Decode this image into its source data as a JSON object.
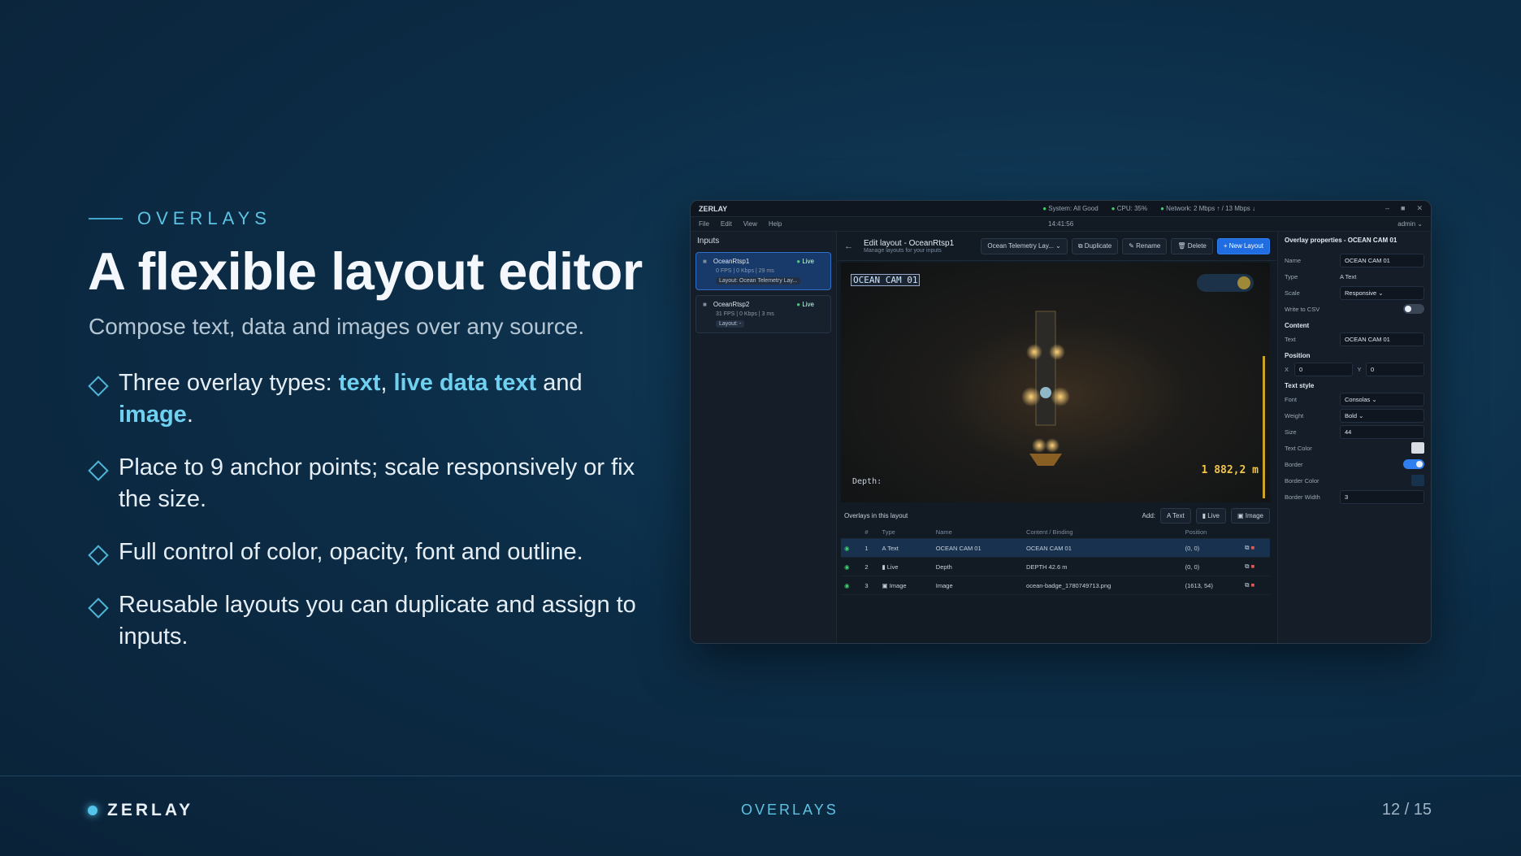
{
  "slide": {
    "kicker": "OVERLAYS",
    "title": "A flexible layout editor",
    "subtitle": "Compose text, data and images over any source.",
    "bullets": {
      "b1_pre": "Three overlay types: ",
      "b1_text": "text",
      "b1_sep": ", ",
      "b1_live": "live data text",
      "b1_and": " and ",
      "b1_image": "image",
      "b1_end": ".",
      "b2": "Place to 9 anchor points; scale responsively or fix the size.",
      "b3": "Full control of color, opacity, font and outline.",
      "b4": "Reusable layouts you can duplicate and assign to inputs."
    },
    "footer": {
      "brand": "ZERLAY",
      "section": "OVERLAYS",
      "page": "12 / 15"
    }
  },
  "app": {
    "title": "ZERLAY",
    "status": {
      "system": "System: All Good",
      "cpu": "CPU: 35%",
      "network": "Network: 2 Mbps ↑ / 13 Mbps ↓"
    },
    "menu": [
      "File",
      "Edit",
      "View",
      "Help"
    ],
    "clock": "14:41:56",
    "user": "admin",
    "inputs_header": "Inputs",
    "inputs": [
      {
        "name": "OceanRtsp1",
        "status": "Live",
        "meta": "0 FPS  |  0 Kbps  |  29 ms",
        "layout": "Layout: Ocean Telemetry Lay..."
      },
      {
        "name": "OceanRtsp2",
        "status": "Live",
        "meta": "31 FPS  |  0 Kbps  |  3 ms",
        "layout": "Layout: -"
      }
    ],
    "editor": {
      "title": "Edit layout - OceanRtsp1",
      "subtitle": "Manage layouts for your inputs",
      "layout_select": "Ocean Telemetry Lay...",
      "duplicate": "Duplicate",
      "rename": "Rename",
      "delete": "Delete",
      "new_layout": "+ New Layout"
    },
    "preview": {
      "cam_label": "OCEAN CAM 01",
      "depth_label": "Depth:",
      "depth_value": "1 882,2 m"
    },
    "overlays": {
      "header": "Overlays in this layout",
      "add_label": "Add:",
      "add_text": "Text",
      "add_live": "Live",
      "add_image": "Image",
      "columns": [
        "#",
        "Type",
        "Name",
        "Content / Binding",
        "Position"
      ],
      "rows": [
        {
          "n": "1",
          "type": "Text",
          "name": "OCEAN CAM 01",
          "content": "OCEAN CAM 01",
          "pos": "(0, 0)"
        },
        {
          "n": "2",
          "type": "Live",
          "name": "Depth",
          "content": "DEPTH 42.6 m",
          "pos": "(0, 0)"
        },
        {
          "n": "3",
          "type": "Image",
          "name": "Image",
          "content": "ocean-badge_1780749713.png",
          "pos": "(1613, 54)"
        }
      ]
    },
    "props": {
      "header": "Overlay properties - OCEAN CAM 01",
      "name_l": "Name",
      "name_v": "OCEAN CAM 01",
      "type_l": "Type",
      "type_v": "Text",
      "scale_l": "Scale",
      "scale_v": "Responsive",
      "csv_l": "Write to CSV",
      "content_h": "Content",
      "text_l": "Text",
      "text_v": "OCEAN CAM 01",
      "position_h": "Position",
      "x_l": "X",
      "x_v": "0",
      "y_l": "Y",
      "y_v": "0",
      "style_h": "Text style",
      "font_l": "Font",
      "font_v": "Consolas",
      "weight_l": "Weight",
      "weight_v": "Bold",
      "size_l": "Size",
      "size_v": "44",
      "tcolor_l": "Text Color",
      "border_l": "Border",
      "bcolor_l": "Border Color",
      "bwidth_l": "Border Width",
      "bwidth_v": "3"
    }
  }
}
